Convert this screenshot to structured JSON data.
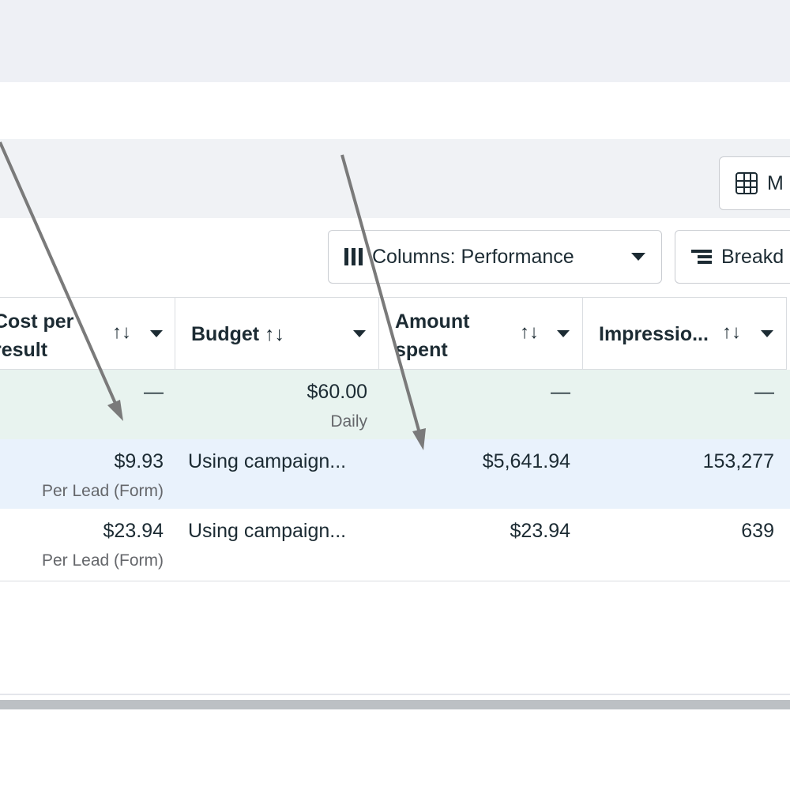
{
  "toolbar": {
    "m_button_label": "M",
    "columns_button_label": "Columns: Performance",
    "breakdown_button_label": "Breakd"
  },
  "table": {
    "headers": [
      {
        "line1": "Cost per",
        "line2": "result"
      },
      {
        "line1": "Budget ↑↓",
        "line2": ""
      },
      {
        "line1": "Amount",
        "line2": "spent"
      },
      {
        "line1": "Impressio...",
        "line2": ""
      }
    ],
    "sort_glyph": "↑↓",
    "total_row": {
      "cost_per_result": "—",
      "budget": "$60.00",
      "budget_sub": "Daily",
      "amount_spent": "—",
      "impressions": "—"
    },
    "rows": [
      {
        "cost_per_result": "$9.93",
        "cost_sub": "Per Lead (Form)",
        "budget": "Using campaign...",
        "amount_spent": "$5,641.94",
        "impressions": "153,277"
      },
      {
        "cost_per_result": "$23.94",
        "cost_sub": "Per Lead (Form)",
        "budget": "Using campaign...",
        "amount_spent": "$23.94",
        "impressions": "639"
      }
    ]
  },
  "colors": {
    "total_row_bg": "#e8f3ef",
    "highlight_row_bg": "#e9f2fc",
    "annotation_arrow": "#7a7a7a"
  },
  "icons": [
    "table-grid-icon",
    "columns-icon",
    "breakdown-icon",
    "sort-icon",
    "dropdown-caret-icon",
    "annotation-arrow-icon"
  ]
}
